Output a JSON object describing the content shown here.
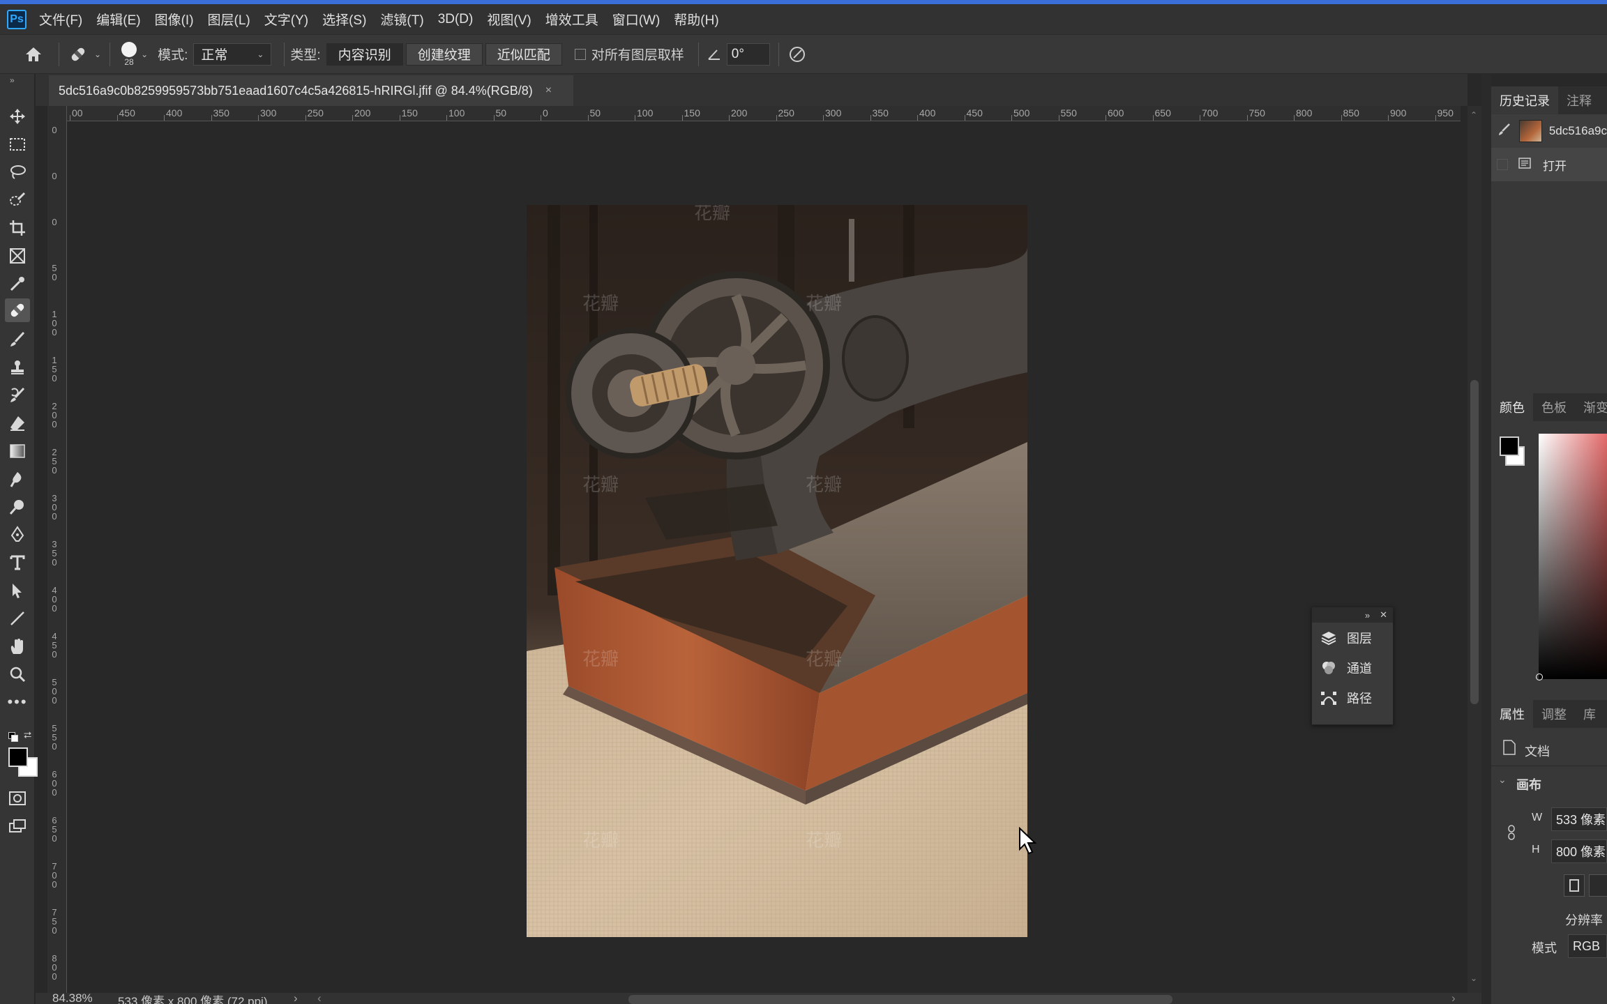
{
  "app": {
    "logo": "Ps"
  },
  "menu": [
    "文件(F)",
    "编辑(E)",
    "图像(I)",
    "图层(L)",
    "文字(Y)",
    "选择(S)",
    "滤镜(T)",
    "3D(D)",
    "视图(V)",
    "增效工具",
    "窗口(W)",
    "帮助(H)"
  ],
  "options": {
    "brush_size": "28",
    "mode_label": "模式:",
    "mode_value": "正常",
    "type_label": "类型:",
    "type_buttons": [
      "内容识别",
      "创建纹理",
      "近似匹配"
    ],
    "sample_all_label": "对所有图层取样",
    "angle_value": "0°"
  },
  "document": {
    "tab_title": "5dc516a9c0b8259959573bb751eaad1607c4c5a426815-hRIRGl.jfif @ 84.4%(RGB/8)",
    "close_glyph": "×"
  },
  "ruler_h": [
    "00",
    "450",
    "400",
    "350",
    "300",
    "250",
    "200",
    "150",
    "100",
    "50",
    "0",
    "50",
    "100",
    "150",
    "200",
    "250",
    "300",
    "350",
    "400",
    "450",
    "500",
    "550",
    "600",
    "650",
    "700",
    "750",
    "800",
    "850",
    "900",
    "950"
  ],
  "ruler_v": [
    "0",
    "0",
    "0",
    "50",
    "100",
    "150",
    "200",
    "250",
    "300",
    "350",
    "400",
    "450",
    "500",
    "550",
    "600",
    "650",
    "700",
    "750",
    "800"
  ],
  "status": {
    "zoom": "84.38%",
    "size": "533 像素 x 800 像素 (72 ppi)"
  },
  "mini_panel": {
    "items": [
      "图层",
      "通道",
      "路径"
    ]
  },
  "history_panel": {
    "tabs": [
      "历史记录",
      "注释"
    ],
    "snapshot_name": "5dc516a9c",
    "steps": [
      "打开"
    ]
  },
  "color_panel": {
    "tabs": [
      "颜色",
      "色板",
      "渐变"
    ]
  },
  "properties_panel": {
    "tabs": [
      "属性",
      "调整",
      "库"
    ],
    "doc_label": "文档",
    "section": "画布",
    "w_label": "W",
    "w_value": "533 像素",
    "h_label": "H",
    "h_value": "800 像素",
    "resolution_label": "分辨率",
    "mode_label": "模式",
    "mode_value": "RGB"
  },
  "colors": {
    "accent": "#3a6ed8",
    "panel": "#383838",
    "bg": "#282828"
  }
}
